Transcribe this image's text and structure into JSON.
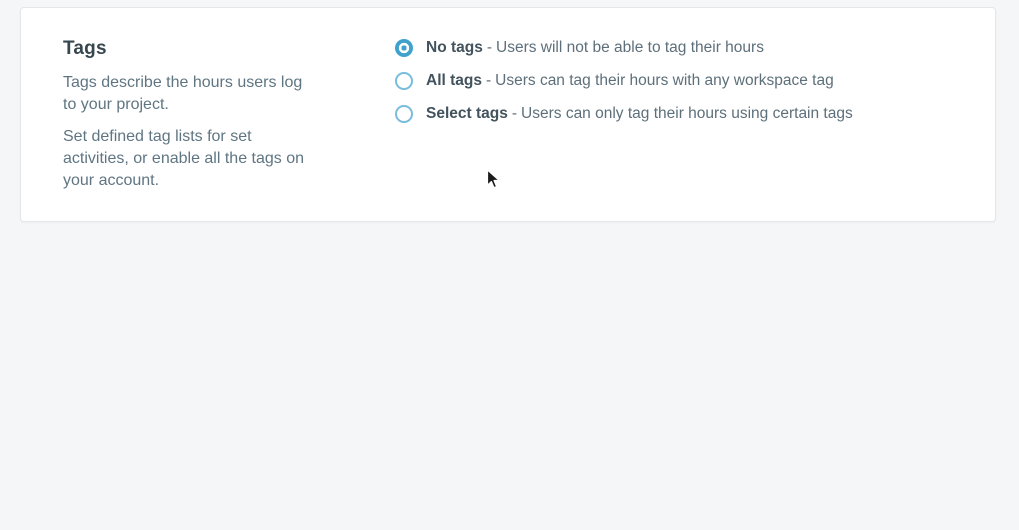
{
  "card": {
    "section": {
      "title": "Tags",
      "paragraphs": [
        "Tags describe the hours users log to your project.",
        "Set defined tag lists for set activities, or enable all the tags on your account."
      ]
    },
    "separator": "-",
    "options": [
      {
        "label": "No tags",
        "description": "Users will not be able to tag their hours",
        "selected": true
      },
      {
        "label": "All tags",
        "description": "Users can tag their hours with any workspace tag",
        "selected": false
      },
      {
        "label": "Select tags",
        "description": "Users can only tag their hours using certain tags",
        "selected": false
      }
    ]
  },
  "colors": {
    "accent_blue": "#3fa2cc",
    "radio_outline_blue": "#79bcdb",
    "heading_text": "#37474f",
    "body_text": "#5f7582",
    "card_background": "#ffffff",
    "card_border": "#e4e7ea",
    "page_background": "#f4f6f8"
  }
}
